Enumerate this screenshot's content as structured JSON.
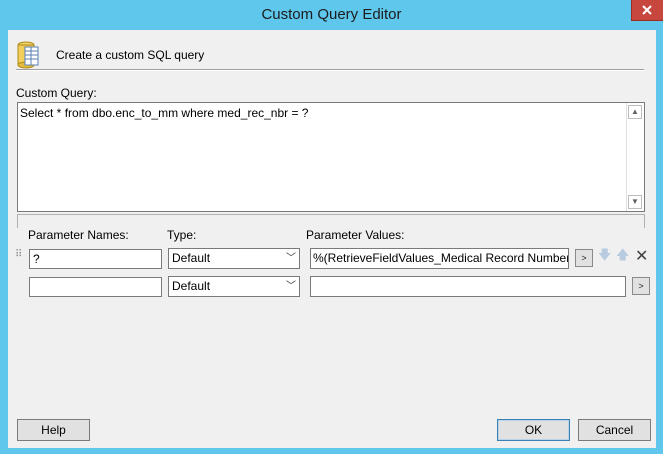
{
  "window": {
    "title": "Custom Query Editor"
  },
  "header": {
    "text": "Create a custom SQL query",
    "icon": "database-table-icon"
  },
  "query": {
    "label": "Custom Query:",
    "text": "Select * from dbo.enc_to_mm where med_rec_nbr = ?"
  },
  "parameters": {
    "headers": {
      "names": "Parameter Names:",
      "type": "Type:",
      "values": "Parameter Values:"
    },
    "rows": [
      {
        "name": "?",
        "type": "Default",
        "value": "%(RetrieveFieldValues_Medical Record Number_All)",
        "expand": ">"
      },
      {
        "name": "",
        "type": "Default",
        "value": "",
        "expand": ">"
      }
    ]
  },
  "buttons": {
    "help": "Help",
    "ok": "OK",
    "cancel": "Cancel"
  }
}
